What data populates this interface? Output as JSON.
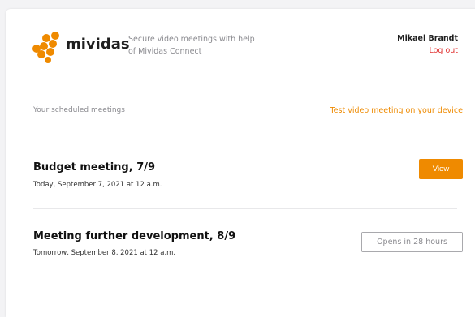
{
  "brand": {
    "name": "mividas",
    "tagline": "Secure video meetings with help of Mividas Connect",
    "accent_color": "#ef8a00",
    "logo_icon": "mividas-dots-logo"
  },
  "user": {
    "name": "Mikael Brandt",
    "logout_label": "Log out"
  },
  "meetings_section": {
    "label": "Your scheduled meetings",
    "test_link": "Test video meeting on your device"
  },
  "meetings": [
    {
      "title": "Budget meeting, 7/9",
      "date": "Today, September 7, 2021 at 12 a.m.",
      "action": "View"
    },
    {
      "title": "Meeting further development, 8/9",
      "date": "Tomorrow, September 8, 2021 at 12 a.m.",
      "action": "Opens in 28 hours"
    }
  ]
}
